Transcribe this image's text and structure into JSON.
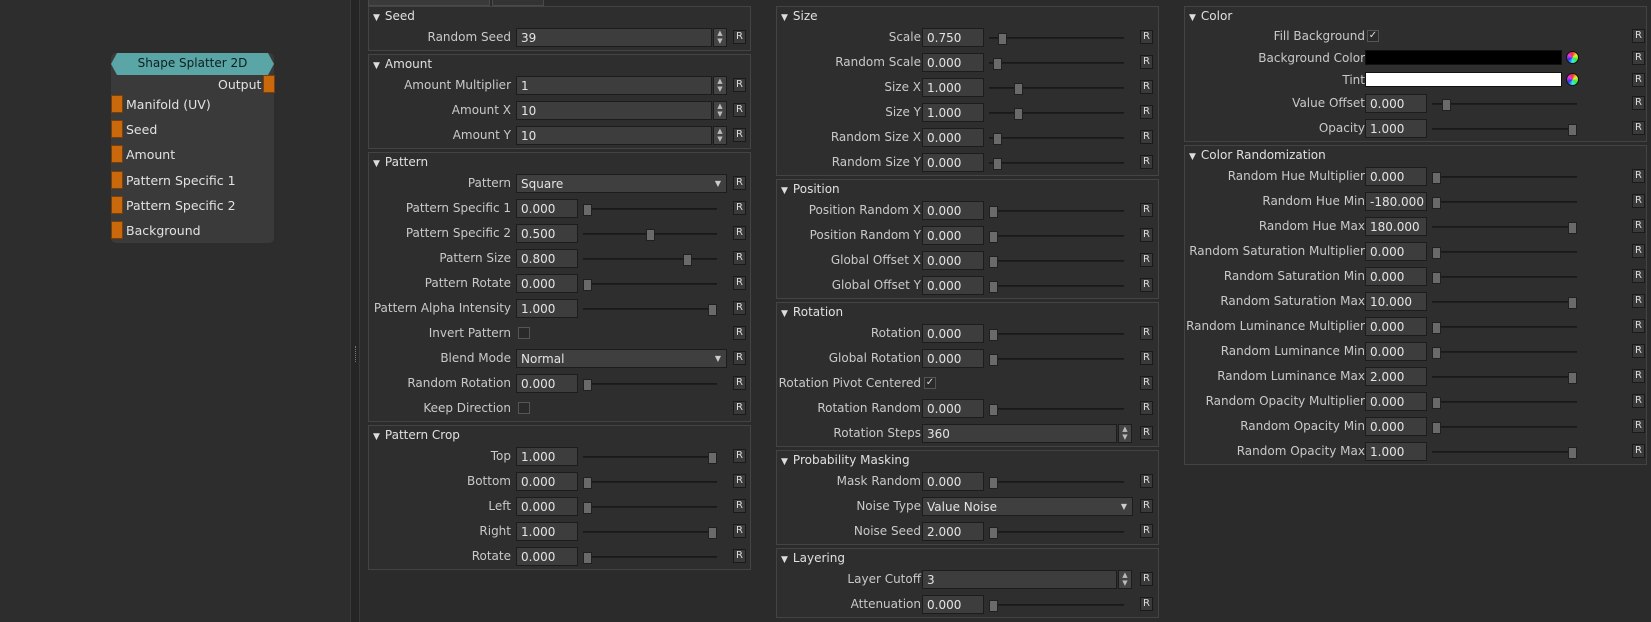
{
  "node": {
    "title": "Shape Splatter 2D",
    "output_label": "Output",
    "inputs": [
      "Manifold (UV)",
      "Seed",
      "Amount",
      "Pattern Specific 1",
      "Pattern Specific 2",
      "Background"
    ]
  },
  "reset_label": "R",
  "check_mark": "✓",
  "spin_up": "▲",
  "spin_down": "▼",
  "drop_arrow": "▼",
  "group_arrow": "▼",
  "columns": [
    [
      {
        "title": "Seed",
        "rows": [
          {
            "label": "Random Seed",
            "type": "spin",
            "value": "39"
          }
        ]
      },
      {
        "title": "Amount",
        "rows": [
          {
            "label": "Amount Multiplier",
            "type": "spin",
            "value": "1"
          },
          {
            "label": "Amount X",
            "type": "spin",
            "value": "10"
          },
          {
            "label": "Amount Y",
            "type": "spin",
            "value": "10"
          }
        ]
      },
      {
        "title": "Pattern",
        "rows": [
          {
            "label": "Pattern",
            "type": "drop",
            "value": "Square"
          },
          {
            "label": "Pattern Specific 1",
            "type": "slider",
            "value": "0.000",
            "pos": 0.0
          },
          {
            "label": "Pattern Specific 2",
            "type": "slider",
            "value": "0.500",
            "pos": 0.5
          },
          {
            "label": "Pattern Size",
            "type": "slider",
            "value": "0.800",
            "pos": 0.8
          },
          {
            "label": "Pattern Rotate",
            "type": "slider",
            "value": "0.000",
            "pos": 0.0
          },
          {
            "label": "Pattern Alpha Intensity",
            "type": "slider",
            "value": "1.000",
            "pos": 1.0
          },
          {
            "label": "Invert Pattern",
            "type": "check",
            "checked": false
          },
          {
            "label": "Blend Mode",
            "type": "drop",
            "value": "Normal"
          },
          {
            "label": "Random Rotation",
            "type": "slider",
            "value": "0.000",
            "pos": 0.0
          },
          {
            "label": "Keep Direction",
            "type": "check",
            "checked": false
          }
        ]
      },
      {
        "title": "Pattern Crop",
        "rows": [
          {
            "label": "Top",
            "type": "slider",
            "value": "1.000",
            "pos": 1.0
          },
          {
            "label": "Bottom",
            "type": "slider",
            "value": "0.000",
            "pos": 0.0
          },
          {
            "label": "Left",
            "type": "slider",
            "value": "0.000",
            "pos": 0.0
          },
          {
            "label": "Right",
            "type": "slider",
            "value": "1.000",
            "pos": 1.0
          },
          {
            "label": "Rotate",
            "type": "slider",
            "value": "0.000",
            "pos": 0.0
          }
        ]
      }
    ],
    [
      {
        "title": "Size",
        "rows": [
          {
            "label": "Scale",
            "type": "slider",
            "value": "0.750",
            "pos": 0.07
          },
          {
            "label": "Random Scale",
            "type": "slider",
            "value": "0.000",
            "pos": 0.03
          },
          {
            "label": "Size X",
            "type": "slider",
            "value": "1.000",
            "pos": 0.2
          },
          {
            "label": "Size Y",
            "type": "slider",
            "value": "1.000",
            "pos": 0.2
          },
          {
            "label": "Random Size X",
            "type": "slider",
            "value": "0.000",
            "pos": 0.03
          },
          {
            "label": "Random Size Y",
            "type": "slider",
            "value": "0.000",
            "pos": 0.03
          }
        ]
      },
      {
        "title": "Position",
        "rows": [
          {
            "label": "Position Random X",
            "type": "slider",
            "value": "0.000",
            "pos": 0.0
          },
          {
            "label": "Position Random Y",
            "type": "slider",
            "value": "0.000",
            "pos": 0.0
          },
          {
            "label": "Global Offset X",
            "type": "slider",
            "value": "0.000",
            "pos": 0.0
          },
          {
            "label": "Global Offset Y",
            "type": "slider",
            "value": "0.000",
            "pos": 0.0
          }
        ]
      },
      {
        "title": "Rotation",
        "rows": [
          {
            "label": "Rotation",
            "type": "slider",
            "value": "0.000",
            "pos": 0.0
          },
          {
            "label": "Global Rotation",
            "type": "slider",
            "value": "0.000",
            "pos": 0.0
          },
          {
            "label": "Rotation Pivot Centered",
            "type": "check",
            "checked": true
          },
          {
            "label": "Rotation Random",
            "type": "slider",
            "value": "0.000",
            "pos": 0.0
          },
          {
            "label": "Rotation Steps",
            "type": "spin",
            "value": "360"
          }
        ]
      },
      {
        "title": "Probability Masking",
        "rows": [
          {
            "label": "Mask Random",
            "type": "slider",
            "value": "0.000",
            "pos": 0.0
          },
          {
            "label": "Noise Type",
            "type": "drop",
            "value": "Value Noise"
          },
          {
            "label": "Noise Seed",
            "type": "slider",
            "value": "2.000",
            "pos": 0.0
          }
        ]
      },
      {
        "title": "Layering",
        "rows": [
          {
            "label": "Layer Cutoff",
            "type": "spin",
            "value": "3"
          },
          {
            "label": "Attenuation",
            "type": "slider",
            "value": "0.000",
            "pos": 0.0
          }
        ]
      }
    ],
    [
      {
        "title": "Color",
        "rows": [
          {
            "label": "Fill Background",
            "type": "check",
            "checked": true,
            "sm": true
          },
          {
            "label": "Background Color",
            "type": "color",
            "color": "#000000",
            "sm": true
          },
          {
            "label": "Tint",
            "type": "color",
            "color": "#ffffff",
            "sm": true
          },
          {
            "label": "Value Offset",
            "type": "slider",
            "value": "0.000",
            "pos": 0.07
          },
          {
            "label": "Opacity",
            "type": "slider",
            "value": "1.000",
            "pos": 1.0
          }
        ]
      },
      {
        "title": "Color Randomization",
        "rows": [
          {
            "label": "Random Hue Multiplier",
            "type": "slider",
            "value": "0.000",
            "pos": 0.0
          },
          {
            "label": "Random Hue Min",
            "type": "slider",
            "value": "-180.000",
            "pos": 0.0
          },
          {
            "label": "Random Hue Max",
            "type": "slider",
            "value": "180.000",
            "pos": 1.0
          },
          {
            "label": "Random Saturation Multiplier",
            "type": "slider",
            "value": "0.000",
            "pos": 0.0
          },
          {
            "label": "Random Saturation Min",
            "type": "slider",
            "value": "0.000",
            "pos": 0.0
          },
          {
            "label": "Random Saturation Max",
            "type": "slider",
            "value": "10.000",
            "pos": 1.0
          },
          {
            "label": "Random Luminance Multiplier",
            "type": "slider",
            "value": "0.000",
            "pos": 0.0
          },
          {
            "label": "Random Luminance Min",
            "type": "slider",
            "value": "0.000",
            "pos": 0.0
          },
          {
            "label": "Random Luminance Max",
            "type": "slider",
            "value": "2.000",
            "pos": 1.0
          },
          {
            "label": "Random Opacity Multiplier",
            "type": "slider",
            "value": "0.000",
            "pos": 0.0
          },
          {
            "label": "Random Opacity Min",
            "type": "slider",
            "value": "0.000",
            "pos": 0.0
          },
          {
            "label": "Random Opacity Max",
            "type": "slider",
            "value": "1.000",
            "pos": 1.0
          }
        ]
      }
    ]
  ]
}
